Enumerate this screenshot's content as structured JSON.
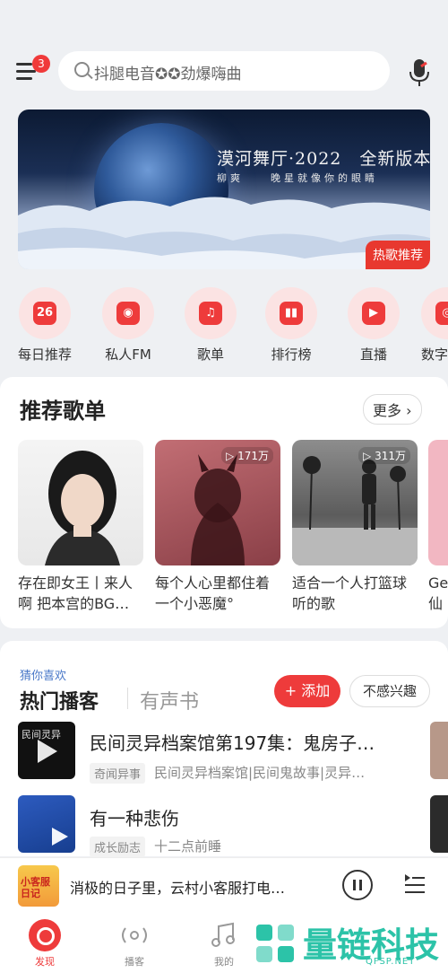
{
  "header": {
    "badge_count": "3",
    "search_placeholder": "抖腿电音✪✪劲爆嗨曲"
  },
  "banner": {
    "title": "漠河舞厅·2022　全新版本",
    "subtitle": "柳爽　　晚星就像你的眼睛",
    "tag": "热歌推荐"
  },
  "quick_links": [
    {
      "label": "每日推荐",
      "icon": "calendar-icon",
      "glyph": "26"
    },
    {
      "label": "私人FM",
      "icon": "radio-icon",
      "glyph": "◉"
    },
    {
      "label": "歌单",
      "icon": "playlist-icon",
      "glyph": "♫"
    },
    {
      "label": "排行榜",
      "icon": "chart-icon",
      "glyph": "▮▮"
    },
    {
      "label": "直播",
      "icon": "live-icon",
      "glyph": "▶"
    },
    {
      "label": "数字",
      "icon": "album-icon",
      "glyph": "◎"
    }
  ],
  "playlists": {
    "title": "推荐歌单",
    "more": "更多",
    "items": [
      {
        "name": "存在即女王丨来人啊 把本宫的BG…",
        "plays": ""
      },
      {
        "name": "每个人心里都住着一个小恶魔°",
        "plays": "171万"
      },
      {
        "name": "适合一个人打篮球听的歌",
        "plays": "311万"
      },
      {
        "name": "Ge仙",
        "plays": ""
      }
    ]
  },
  "podcasts": {
    "guess_label": "猜你喜欢",
    "tab_active": "热门播客",
    "tab_inactive": "有声书",
    "add_label": "+ 添加",
    "dislike_label": "不感兴趣",
    "items": [
      {
        "title": "民间灵异档案馆第197集：鬼房子…",
        "tag": "奇闻异事",
        "desc": "民间灵异档案馆|民间鬼故事|灵异…",
        "thumb_text": "民间灵异"
      },
      {
        "title": "有一种悲伤",
        "tag": "成长励志",
        "desc": "十二点前睡",
        "thumb_text": ""
      }
    ]
  },
  "player": {
    "song": "消极的日子里，云村小客服打电…",
    "cover_text": "小客服日记"
  },
  "tabbar": {
    "tabs": [
      {
        "label": "发现",
        "active": true
      },
      {
        "label": "播客",
        "active": false
      },
      {
        "label": "我的",
        "active": false
      },
      {
        "label": "",
        "active": false
      }
    ]
  },
  "watermark": {
    "text": "量链科技",
    "url": "QFSP.NET"
  },
  "colors": {
    "accent": "#ee3b3b",
    "background": "#eef0f3"
  }
}
